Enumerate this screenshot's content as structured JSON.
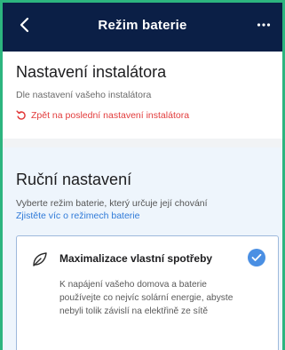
{
  "header": {
    "title": "Režim baterie",
    "back_icon": "chevron-left-icon",
    "more_icon": "more-horizontal-icon"
  },
  "installer": {
    "title": "Nastavení instalátora",
    "subtitle": "Dle nastavení vašeho instalátora",
    "reset_label": "Zpět na poslední nastavení instalátora",
    "reset_icon": "undo-icon"
  },
  "manual": {
    "title": "Ruční nastavení",
    "description": "Vyberte režim baterie, který určuje její chování",
    "link": "Zjistěte víc o režimech baterie",
    "selected_mode": {
      "icon": "leaf-icon",
      "title": "Maximalizace vlastní spotřeby",
      "description": "K napájení vašeho domova a baterie používejte co nejvíc solární energie, abyste nebyli tolik závislí na elektřině ze sítě",
      "selected": true
    }
  },
  "colors": {
    "header_bg": "#0b1f46",
    "accent_green": "#2db57f",
    "reset_red": "#e23b3b",
    "link_blue": "#2f7ad8",
    "check_blue": "#4a8fe3"
  }
}
